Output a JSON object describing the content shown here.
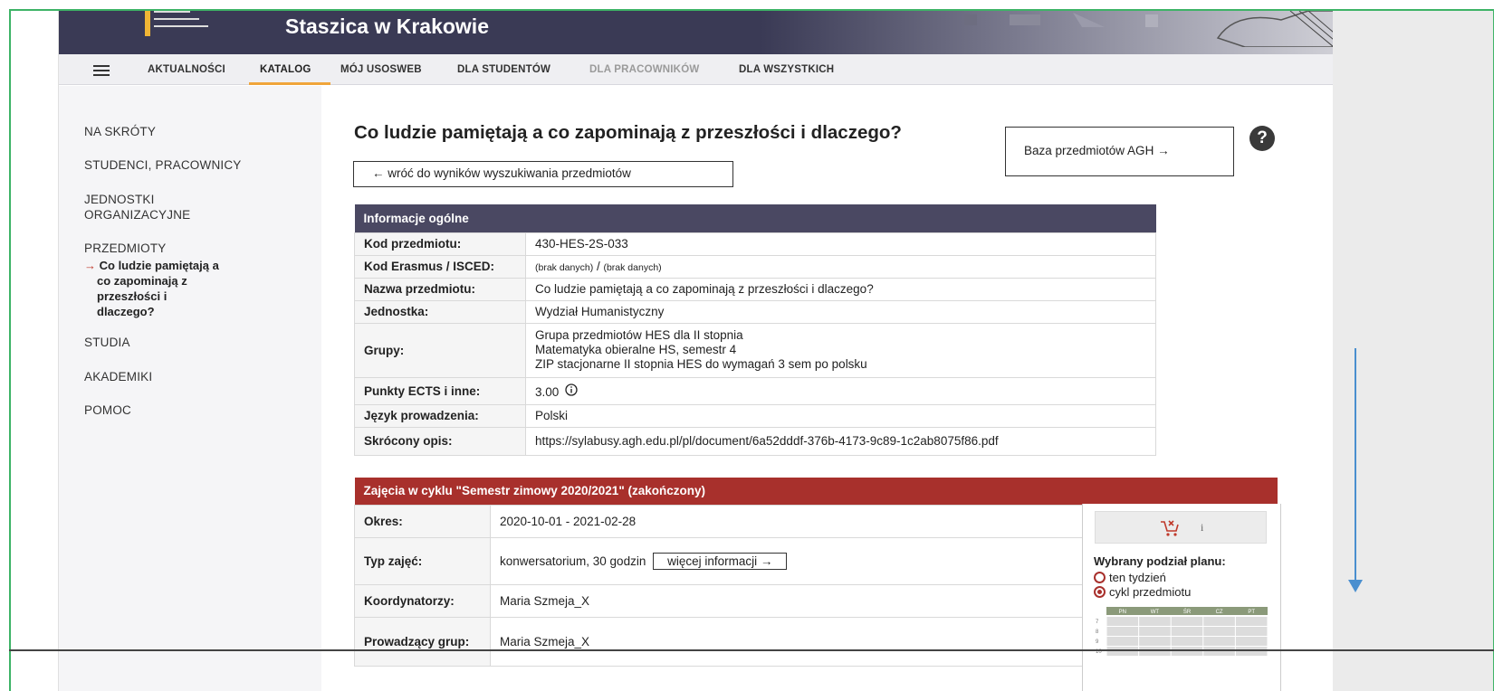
{
  "banner": {
    "title": "Staszica w Krakowie"
  },
  "nav": {
    "items": [
      {
        "label": "AKTUALNOŚCI"
      },
      {
        "label": "KATALOG"
      },
      {
        "label": "MÓJ USOSWEB"
      },
      {
        "label": "DLA STUDENTÓW"
      },
      {
        "label": "DLA PRACOWNIKÓW"
      },
      {
        "label": "DLA WSZYSTKICH"
      }
    ],
    "active": "KATALOG"
  },
  "sidebar": {
    "items": [
      "NA SKRÓTY",
      "STUDENCI, PRACOWNICY",
      "JEDNOSTKI",
      "ORGANIZACYJNE",
      "PRZEDMIOTY",
      "STUDIA",
      "AKADEMIKI",
      "POMOC"
    ],
    "current": {
      "arrow": "→",
      "lines": [
        "Co ludzie pamiętają a",
        "co zapominają z",
        "przeszłości i",
        "dlaczego?"
      ]
    }
  },
  "main": {
    "title": "Co ludzie pamiętają a co zapominają z przeszłości i dlaczego?",
    "back_button": "←  wróć do wyników wyszukiwania przedmiotów",
    "baza_button": "Baza przedmiotów AGH  →",
    "help": "?"
  },
  "info": {
    "header": "Informacje ogólne",
    "rows": [
      {
        "key": "Kod przedmiotu:",
        "value": "430-HES-2S-033"
      },
      {
        "key": "Kod Erasmus / ISCED:",
        "value_small1": "(brak danych)",
        "sep": " / ",
        "value_small2": "(brak danych)"
      },
      {
        "key": "Nazwa przedmiotu:",
        "value": "Co ludzie pamiętają a co zapominają z przeszłości i dlaczego?"
      },
      {
        "key": "Jednostka:",
        "value": "Wydział Humanistyczny"
      },
      {
        "key": "Grupy:",
        "lines": [
          "Grupa przedmiotów HES dla II stopnia",
          "Matematyka obieralne HS, semestr 4",
          "ZIP stacjonarne II stopnia HES do wymagań 3 sem po polsku"
        ]
      },
      {
        "key": "Punkty ECTS i inne:",
        "value": "3.00",
        "icon": "info-circle-icon"
      },
      {
        "key": "Język prowadzenia:",
        "value": "Polski"
      },
      {
        "key": "Skrócony opis:",
        "value": "https://sylabusy.agh.edu.pl/pl/document/6a52dddf-376b-4173-9c89-1c2ab8075f86.pdf"
      }
    ]
  },
  "cycle": {
    "header": "Zajęcia w cyklu \"Semestr zimowy 2020/2021\" (zakończony)",
    "rows": [
      {
        "key": "Okres:",
        "value": "2020-10-01 - 2021-02-28"
      },
      {
        "key": "Typ zajęć:",
        "value": "konwersatorium, 30 godzin",
        "button": "więcej informacji  →"
      },
      {
        "key": "Koordynatorzy:",
        "value": "Maria Szmeja_X"
      },
      {
        "key": "Prowadzący grup:",
        "value": "Maria Szmeja_X"
      }
    ],
    "plan": {
      "cart_icon": "cart-remove-icon",
      "info": "i",
      "title": "Wybrany podział planu:",
      "options": [
        "ten tydzień",
        "cykl przedmiotu"
      ],
      "selected": "cykl przedmiotu",
      "days": [
        "PN",
        "WT",
        "ŚR",
        "CZ",
        "PT"
      ],
      "hours": [
        "7",
        "8",
        "9",
        "10"
      ]
    }
  },
  "colors": {
    "banner": "#3a3a55",
    "table_head": "#4a4862",
    "cycle_head": "#a8302c",
    "accent": "#f0a53a",
    "arrow": "#4a8fcf"
  }
}
